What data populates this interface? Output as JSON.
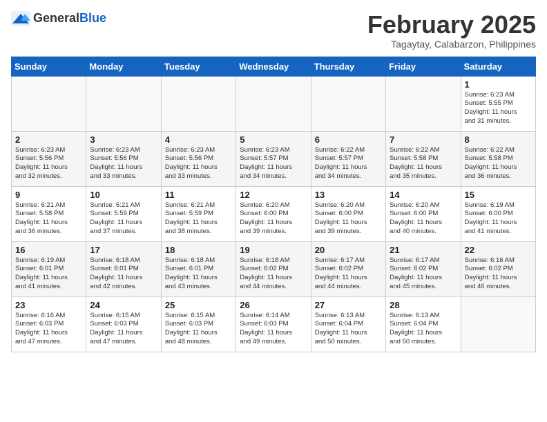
{
  "logo": {
    "general": "General",
    "blue": "Blue"
  },
  "title": {
    "month": "February 2025",
    "location": "Tagaytay, Calabarzon, Philippines"
  },
  "weekdays": [
    "Sunday",
    "Monday",
    "Tuesday",
    "Wednesday",
    "Thursday",
    "Friday",
    "Saturday"
  ],
  "weeks": [
    [
      {
        "day": "",
        "info": ""
      },
      {
        "day": "",
        "info": ""
      },
      {
        "day": "",
        "info": ""
      },
      {
        "day": "",
        "info": ""
      },
      {
        "day": "",
        "info": ""
      },
      {
        "day": "",
        "info": ""
      },
      {
        "day": "1",
        "info": "Sunrise: 6:23 AM\nSunset: 5:55 PM\nDaylight: 11 hours\nand 31 minutes."
      }
    ],
    [
      {
        "day": "2",
        "info": "Sunrise: 6:23 AM\nSunset: 5:56 PM\nDaylight: 11 hours\nand 32 minutes."
      },
      {
        "day": "3",
        "info": "Sunrise: 6:23 AM\nSunset: 5:56 PM\nDaylight: 11 hours\nand 33 minutes."
      },
      {
        "day": "4",
        "info": "Sunrise: 6:23 AM\nSunset: 5:56 PM\nDaylight: 11 hours\nand 33 minutes."
      },
      {
        "day": "5",
        "info": "Sunrise: 6:23 AM\nSunset: 5:57 PM\nDaylight: 11 hours\nand 34 minutes."
      },
      {
        "day": "6",
        "info": "Sunrise: 6:22 AM\nSunset: 5:57 PM\nDaylight: 11 hours\nand 34 minutes."
      },
      {
        "day": "7",
        "info": "Sunrise: 6:22 AM\nSunset: 5:58 PM\nDaylight: 11 hours\nand 35 minutes."
      },
      {
        "day": "8",
        "info": "Sunrise: 6:22 AM\nSunset: 5:58 PM\nDaylight: 11 hours\nand 36 minutes."
      }
    ],
    [
      {
        "day": "9",
        "info": "Sunrise: 6:21 AM\nSunset: 5:58 PM\nDaylight: 11 hours\nand 36 minutes."
      },
      {
        "day": "10",
        "info": "Sunrise: 6:21 AM\nSunset: 5:59 PM\nDaylight: 11 hours\nand 37 minutes."
      },
      {
        "day": "11",
        "info": "Sunrise: 6:21 AM\nSunset: 5:59 PM\nDaylight: 11 hours\nand 38 minutes."
      },
      {
        "day": "12",
        "info": "Sunrise: 6:20 AM\nSunset: 6:00 PM\nDaylight: 11 hours\nand 39 minutes."
      },
      {
        "day": "13",
        "info": "Sunrise: 6:20 AM\nSunset: 6:00 PM\nDaylight: 11 hours\nand 39 minutes."
      },
      {
        "day": "14",
        "info": "Sunrise: 6:20 AM\nSunset: 6:00 PM\nDaylight: 11 hours\nand 40 minutes."
      },
      {
        "day": "15",
        "info": "Sunrise: 6:19 AM\nSunset: 6:00 PM\nDaylight: 11 hours\nand 41 minutes."
      }
    ],
    [
      {
        "day": "16",
        "info": "Sunrise: 6:19 AM\nSunset: 6:01 PM\nDaylight: 11 hours\nand 41 minutes."
      },
      {
        "day": "17",
        "info": "Sunrise: 6:18 AM\nSunset: 6:01 PM\nDaylight: 11 hours\nand 42 minutes."
      },
      {
        "day": "18",
        "info": "Sunrise: 6:18 AM\nSunset: 6:01 PM\nDaylight: 11 hours\nand 43 minutes."
      },
      {
        "day": "19",
        "info": "Sunrise: 6:18 AM\nSunset: 6:02 PM\nDaylight: 11 hours\nand 44 minutes."
      },
      {
        "day": "20",
        "info": "Sunrise: 6:17 AM\nSunset: 6:02 PM\nDaylight: 11 hours\nand 44 minutes."
      },
      {
        "day": "21",
        "info": "Sunrise: 6:17 AM\nSunset: 6:02 PM\nDaylight: 11 hours\nand 45 minutes."
      },
      {
        "day": "22",
        "info": "Sunrise: 6:16 AM\nSunset: 6:02 PM\nDaylight: 11 hours\nand 46 minutes."
      }
    ],
    [
      {
        "day": "23",
        "info": "Sunrise: 6:16 AM\nSunset: 6:03 PM\nDaylight: 11 hours\nand 47 minutes."
      },
      {
        "day": "24",
        "info": "Sunrise: 6:15 AM\nSunset: 6:03 PM\nDaylight: 11 hours\nand 47 minutes."
      },
      {
        "day": "25",
        "info": "Sunrise: 6:15 AM\nSunset: 6:03 PM\nDaylight: 11 hours\nand 48 minutes."
      },
      {
        "day": "26",
        "info": "Sunrise: 6:14 AM\nSunset: 6:03 PM\nDaylight: 11 hours\nand 49 minutes."
      },
      {
        "day": "27",
        "info": "Sunrise: 6:13 AM\nSunset: 6:04 PM\nDaylight: 11 hours\nand 50 minutes."
      },
      {
        "day": "28",
        "info": "Sunrise: 6:13 AM\nSunset: 6:04 PM\nDaylight: 11 hours\nand 50 minutes."
      },
      {
        "day": "",
        "info": ""
      }
    ]
  ]
}
